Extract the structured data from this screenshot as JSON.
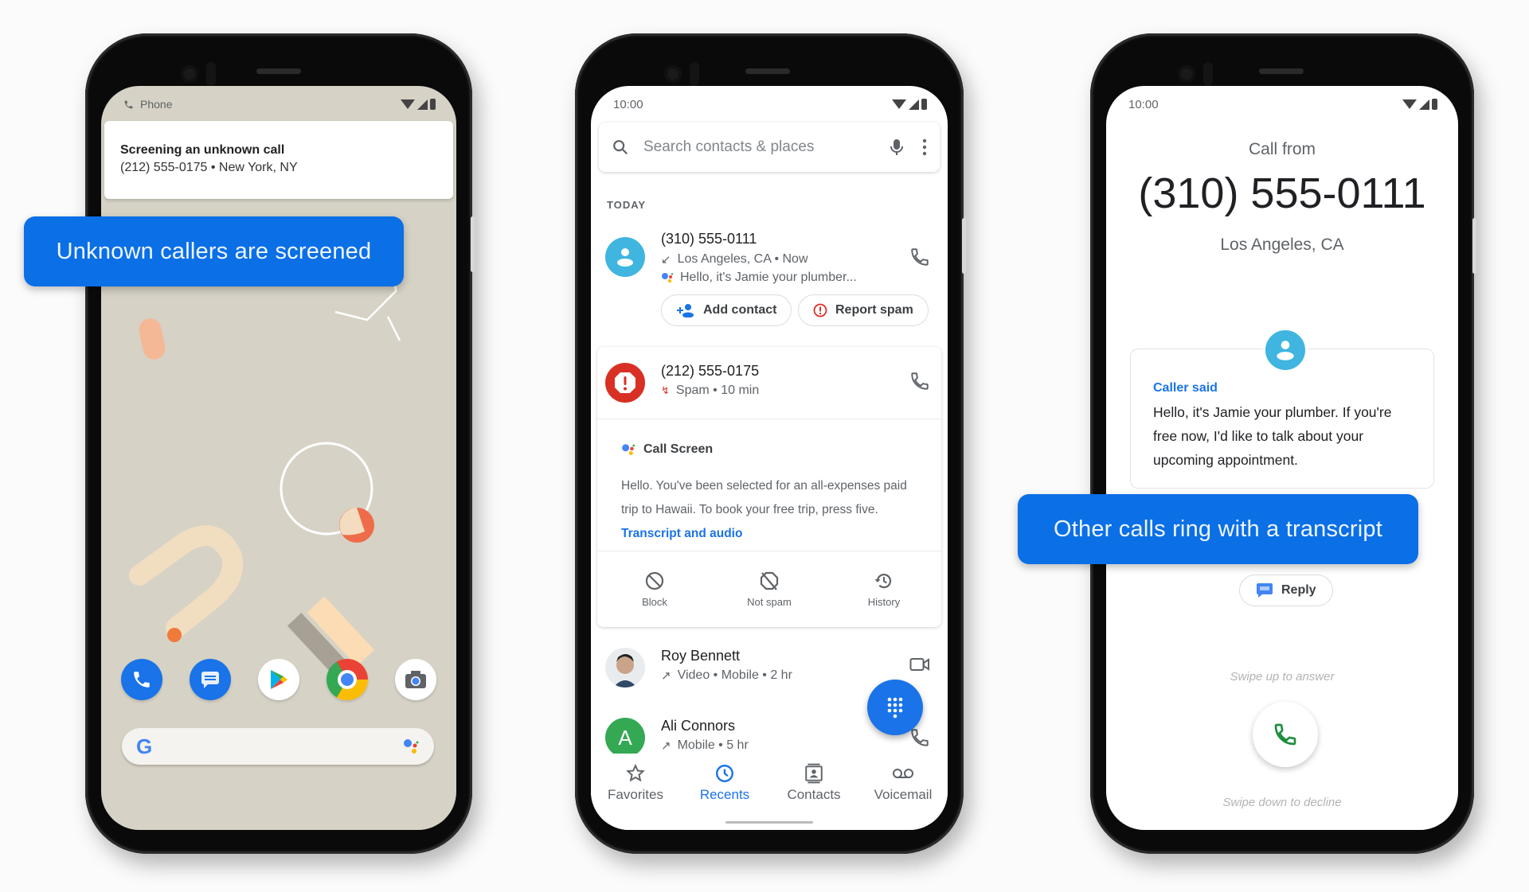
{
  "phones": {
    "left": {
      "status_app": "Phone",
      "notification": {
        "title": "Screening an unknown call",
        "subtitle": "(212) 555-0175 • New York, NY"
      },
      "dock_apps": [
        "phone-app",
        "messages-app",
        "play-store-app",
        "chrome-app",
        "camera-app"
      ],
      "search_logo": "G"
    },
    "middle": {
      "time": "10:00",
      "search_placeholder": "Search contacts & places",
      "section_label": "TODAY",
      "calls": [
        {
          "number": "(310) 555-0111",
          "detail": "Los Angeles, CA • Now",
          "snippet": "Hello, it's Jamie your plumber...",
          "actions": [
            "Add contact",
            "Report spam"
          ]
        },
        {
          "number": "(212) 555-0175",
          "detail": "Spam • 10 min",
          "call_screen": {
            "title": "Call Screen",
            "transcript": "Hello. You've been selected for an all-expenses paid trip to Hawaii. To book your free trip, press five.",
            "link": "Transcript and audio"
          },
          "actions": [
            "Block",
            "Not spam",
            "History"
          ]
        },
        {
          "name": "Roy Bennett",
          "detail": "Video • Mobile • 2 hr"
        },
        {
          "name": "Ali Connors",
          "initial": "A",
          "detail": "Mobile • 5 hr"
        }
      ],
      "nav": [
        {
          "label": "Favorites",
          "active": false
        },
        {
          "label": "Recents",
          "active": true
        },
        {
          "label": "Contacts",
          "active": false
        },
        {
          "label": "Voicemail",
          "active": false
        }
      ]
    },
    "right": {
      "time": "10:00",
      "call_from_label": "Call from",
      "number": "(310) 555-0111",
      "location": "Los Angeles, CA",
      "caller_said_label": "Caller said",
      "caller_message": "Hello, it's Jamie your plumber. If you're free now, I'd like to talk about your upcoming appointment.",
      "reply_label": "Reply",
      "swipe_up": "Swipe up to answer",
      "swipe_down": "Swipe down to decline"
    }
  },
  "callouts": {
    "left": "Unknown callers are screened",
    "right": "Other calls ring with a transcript"
  },
  "colors": {
    "accent_blue": "#1a73e8",
    "callout_blue": "#0b6fe6",
    "spam_red": "#d93025",
    "avatar_cyan": "#3fb5e0",
    "contact_green": "#34a853",
    "wallpaper": "#d6d2c6"
  }
}
